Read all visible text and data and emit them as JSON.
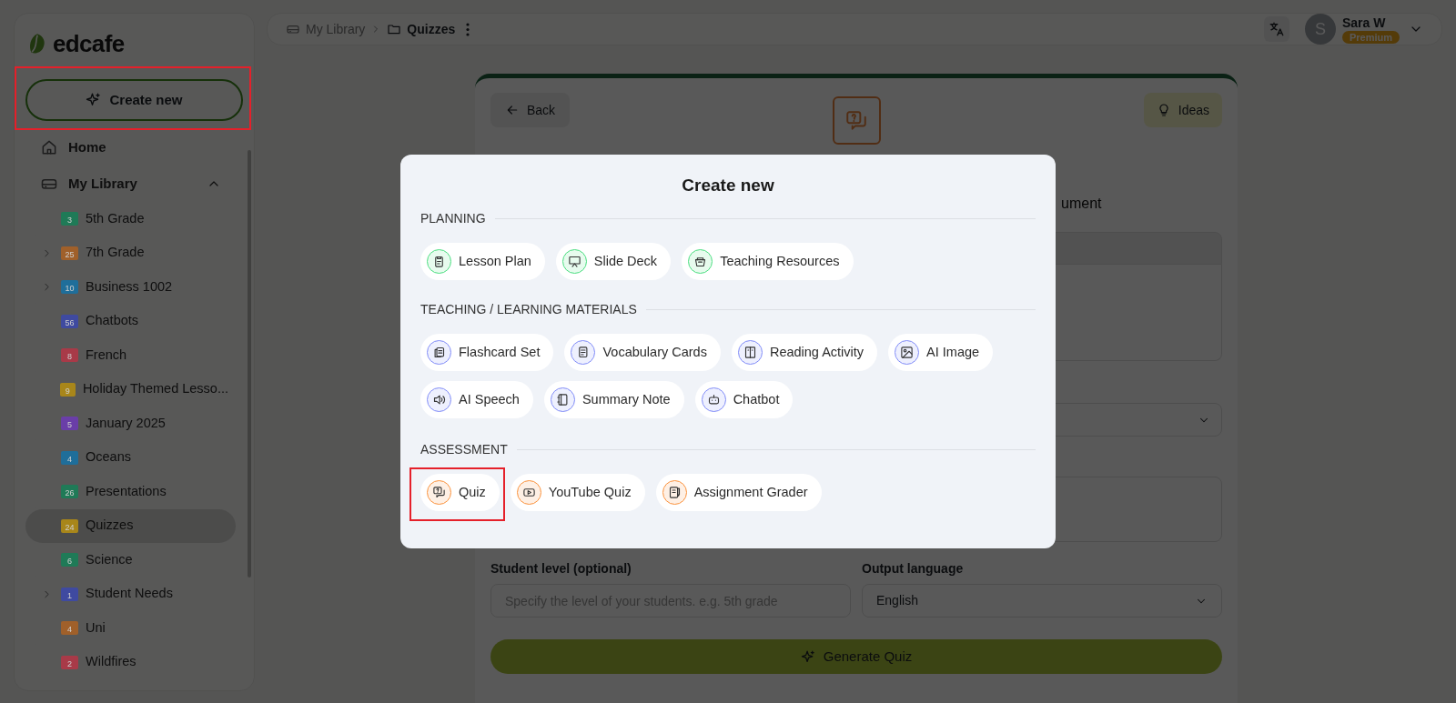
{
  "sidebar": {
    "logo": "edcafe",
    "create_button": {
      "label": "Create new",
      "highlighted": true
    },
    "nav": [
      {
        "label": "Home"
      },
      {
        "label": "My Library",
        "expanded": true
      }
    ],
    "folders": [
      {
        "label": "5th Grade",
        "count": "3",
        "color": "#1f7a57",
        "has_children": false,
        "selected": false
      },
      {
        "label": "7th Grade",
        "count": "25",
        "color": "#a0602a",
        "has_children": true,
        "selected": false
      },
      {
        "label": "Business 1002",
        "count": "10",
        "color": "#1f6e9a",
        "has_children": true,
        "selected": false
      },
      {
        "label": "Chatbots",
        "count": "56",
        "color": "#3f4aa0",
        "has_children": false,
        "selected": false
      },
      {
        "label": "French",
        "count": "8",
        "color": "#a83a48",
        "has_children": false,
        "selected": false
      },
      {
        "label": "Holiday Themed Lesso...",
        "count": "9",
        "color": "#a8861a",
        "has_children": false,
        "selected": false
      },
      {
        "label": "January 2025",
        "count": "5",
        "color": "#6a3ea8",
        "has_children": false,
        "selected": false
      },
      {
        "label": "Oceans",
        "count": "4",
        "color": "#1f6e9a",
        "has_children": false,
        "selected": false
      },
      {
        "label": "Presentations",
        "count": "26",
        "color": "#1f7a57",
        "has_children": false,
        "selected": false
      },
      {
        "label": "Quizzes",
        "count": "24",
        "color": "#a8861a",
        "has_children": false,
        "selected": true
      },
      {
        "label": "Science",
        "count": "6",
        "color": "#1f7a57",
        "has_children": false,
        "selected": false
      },
      {
        "label": "Student Needs",
        "count": "1",
        "color": "#3f4aa0",
        "has_children": true,
        "selected": false
      },
      {
        "label": "Uni",
        "count": "4",
        "color": "#a0602a",
        "has_children": false,
        "selected": false
      },
      {
        "label": "Wildfires",
        "count": "2",
        "color": "#a83a48",
        "has_children": false,
        "selected": false
      }
    ]
  },
  "header": {
    "breadcrumb": [
      "My Library",
      "Quizzes"
    ],
    "user": {
      "initial": "S",
      "name": "Sara W",
      "plan": "Premium"
    }
  },
  "editor": {
    "back": "Back",
    "ideas": "Ideas",
    "subtitle_visible": "ument",
    "student_level": {
      "label": "Student level (optional)",
      "placeholder": "Specify the level of your students. e.g. 5th grade"
    },
    "output_language": {
      "label": "Output language",
      "value": "English"
    },
    "generate": "Generate Quiz"
  },
  "modal": {
    "title": "Create new",
    "sections": [
      {
        "title": "PLANNING",
        "color": "#4ade80",
        "items": [
          {
            "label": "Lesson Plan",
            "highlighted": false
          },
          {
            "label": "Slide Deck",
            "highlighted": false
          },
          {
            "label": "Teaching Resources",
            "highlighted": false
          }
        ]
      },
      {
        "title": "TEACHING / LEARNING MATERIALS",
        "color": "#818cf8",
        "items": [
          {
            "label": "Flashcard Set",
            "highlighted": false
          },
          {
            "label": "Vocabulary Cards",
            "highlighted": false
          },
          {
            "label": "Reading Activity",
            "highlighted": false
          },
          {
            "label": "AI Image",
            "highlighted": false
          },
          {
            "label": "AI Speech",
            "highlighted": false
          },
          {
            "label": "Summary Note",
            "highlighted": false
          },
          {
            "label": "Chatbot",
            "highlighted": false
          }
        ]
      },
      {
        "title": "ASSESSMENT",
        "color": "#fb923c",
        "items": [
          {
            "label": "Quiz",
            "highlighted": true
          },
          {
            "label": "YouTube Quiz",
            "highlighted": false
          },
          {
            "label": "Assignment Grader",
            "highlighted": false
          }
        ]
      }
    ]
  }
}
